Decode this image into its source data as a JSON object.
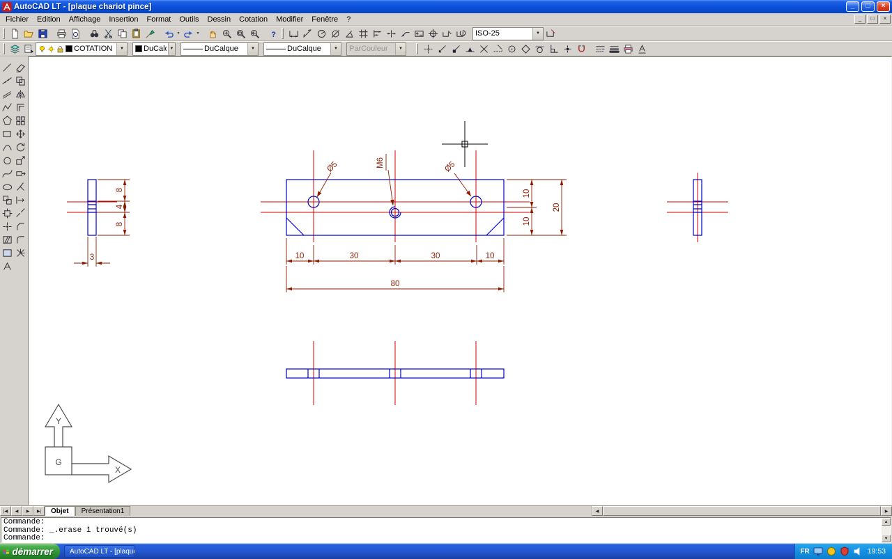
{
  "colors": {
    "geometry": "#0000c8",
    "centerline": "#d40000",
    "dimension": "#8b1a00",
    "canvas_background": "#ffffff",
    "titlebar_blue": "#0a4fd8",
    "start_green": "#2f9232"
  },
  "window": {
    "title": "AutoCAD LT - [plaque chariot pince]",
    "minimize": "_",
    "maximize": "□",
    "close": "×"
  },
  "document": {
    "minimize": "_",
    "restore": "□",
    "close": "×"
  },
  "menu": {
    "items": [
      "Fichier",
      "Edition",
      "Affichage",
      "Insertion",
      "Format",
      "Outils",
      "Dessin",
      "Cotation",
      "Modifier",
      "Fenêtre",
      "?"
    ]
  },
  "toolbars": {
    "dimstyle": "ISO-25",
    "layer": "COTATION",
    "color": "DuCalque",
    "linetype": "DuCalque",
    "lineweight": "DuCalque",
    "plotstyle": "ParCouleur",
    "help": "?"
  },
  "glyphs": {
    "dropdown": "▼",
    "nav_first": "|◀",
    "nav_prev": "◀",
    "nav_next": "▶",
    "nav_last": "▶|",
    "left": "◀",
    "right": "▶",
    "up": "▲",
    "down": "▼"
  },
  "tabs": {
    "model": "Objet",
    "layout1": "Présentation1"
  },
  "command": {
    "line1": "Commande:",
    "line2": "Commande: _.erase 1 trouvé(s)",
    "line3": "Commande:"
  },
  "taskbar": {
    "start": "démarrer",
    "task": "AutoCAD LT - [plaque...",
    "language": "FR",
    "time": "19:53"
  },
  "drawing": {
    "labels": {
      "hole_left": "Ø5",
      "hole_center": "M6",
      "hole_right": "Ø5",
      "w10a": "10",
      "w30a": "30",
      "w30b": "30",
      "w10b": "10",
      "w80": "80",
      "h10a": "10",
      "h10b": "10",
      "h20": "20",
      "t8a": "8",
      "t4": "4",
      "t8b": "8",
      "t3": "3",
      "ucs_y": "Y",
      "ucs_g": "G",
      "ucs_x": "X"
    }
  }
}
